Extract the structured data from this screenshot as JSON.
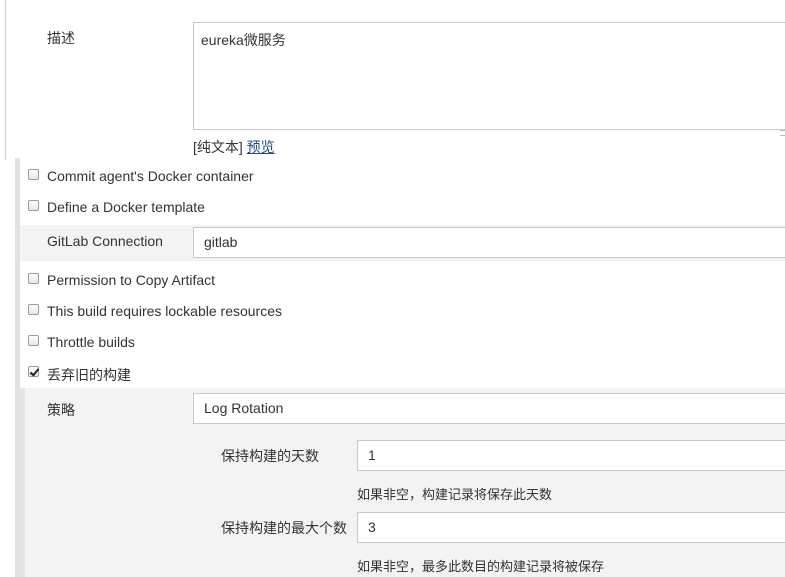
{
  "description": {
    "label": "描述",
    "value": "eureka微服务",
    "format_text": "[纯文本]",
    "preview_link": "预览"
  },
  "options": {
    "commit_docker": {
      "label": "Commit agent's Docker container",
      "checked": false
    },
    "docker_template": {
      "label": "Define a Docker template",
      "checked": false
    },
    "permission_copy": {
      "label": "Permission to Copy Artifact",
      "checked": false
    },
    "lockable": {
      "label": "This build requires lockable resources",
      "checked": false
    },
    "throttle": {
      "label": "Throttle builds",
      "checked": false
    },
    "discard_old": {
      "label": "丢弃旧的构建",
      "checked": true
    }
  },
  "gitlab": {
    "label": "GitLab Connection",
    "value": "gitlab"
  },
  "strategy": {
    "label": "策略",
    "value": "Log Rotation",
    "days": {
      "label": "保持构建的天数",
      "value": "1",
      "help": "如果非空，构建记录将保存此天数"
    },
    "max": {
      "label": "保持构建的最大个数",
      "value": "3",
      "help": "如果非空，最多此数目的构建记录将被保存"
    }
  }
}
